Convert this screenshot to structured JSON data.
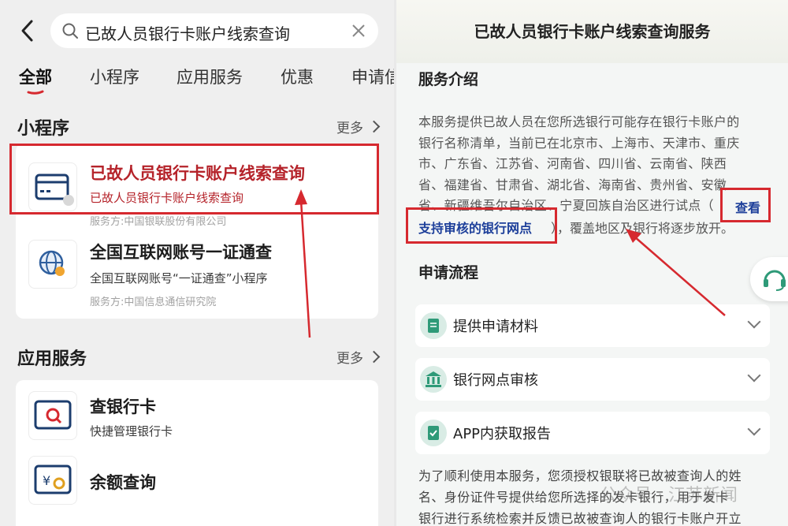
{
  "left": {
    "search": {
      "query": "已故人员银行卡账户线索查询"
    },
    "tabs": [
      {
        "label": "全部"
      },
      {
        "label": "小程序"
      },
      {
        "label": "应用服务"
      },
      {
        "label": "优惠"
      },
      {
        "label": "申请信"
      }
    ],
    "mini_programs": {
      "title": "小程序",
      "more": "更多",
      "items": [
        {
          "title": "已故人员银行卡账户线索查询",
          "subtitle": "已故人员银行卡账户线索查询",
          "provider": "服务方:中国银联股份有限公司"
        },
        {
          "title": "全国互联网账号一证通查",
          "subtitle": "全国互联网账号“一证通查”小程序",
          "provider": "服务方:中国信息通信研究院"
        }
      ]
    },
    "app_services": {
      "title": "应用服务",
      "more": "更多",
      "items": [
        {
          "title": "查银行卡",
          "subtitle": "快捷管理银行卡"
        },
        {
          "title": "余额查询",
          "subtitle": ""
        }
      ]
    }
  },
  "right": {
    "title": "已故人员银行卡账户线索查询服务",
    "intro_section": "服务介绍",
    "intro_text": "本服务提供已故人员在您所选银行可能存在银行卡账户的\n银行名称清单，当前已在北京市、上海市、天津市、重庆\n市、广东省、江苏省、河南省、四川省、云南省、陕西\n省、福建省、甘肃省、湖北省、海南省、贵州省、安徽\n省、新疆维吾尔自治区、宁夏回族自治区进行试点（",
    "link_part1": "查看",
    "link_part2": "支持审核的银行网点",
    "intro_tail": "），覆盖地区及银行将逐步放开。",
    "process_section": "申请流程",
    "steps": [
      {
        "label": "提供申请材料",
        "icon": "document-icon"
      },
      {
        "label": "银行网点审核",
        "icon": "bank-icon"
      },
      {
        "label": "APP内获取报告",
        "icon": "report-icon"
      }
    ],
    "footnote": "为了顺利使用本服务，您须授权银联将已故被查询人的姓\n名、身份证件号提供给您所选择的发卡银行，用于发卡\n银行进行系统检索并反馈已故被查询人的银行卡账户开立",
    "watermark": "公众号 · 江苏新闻"
  },
  "colors": {
    "highlight_red": "#d6292f",
    "link_blue": "#1d3f9a",
    "accent_green": "#2e9a78"
  }
}
